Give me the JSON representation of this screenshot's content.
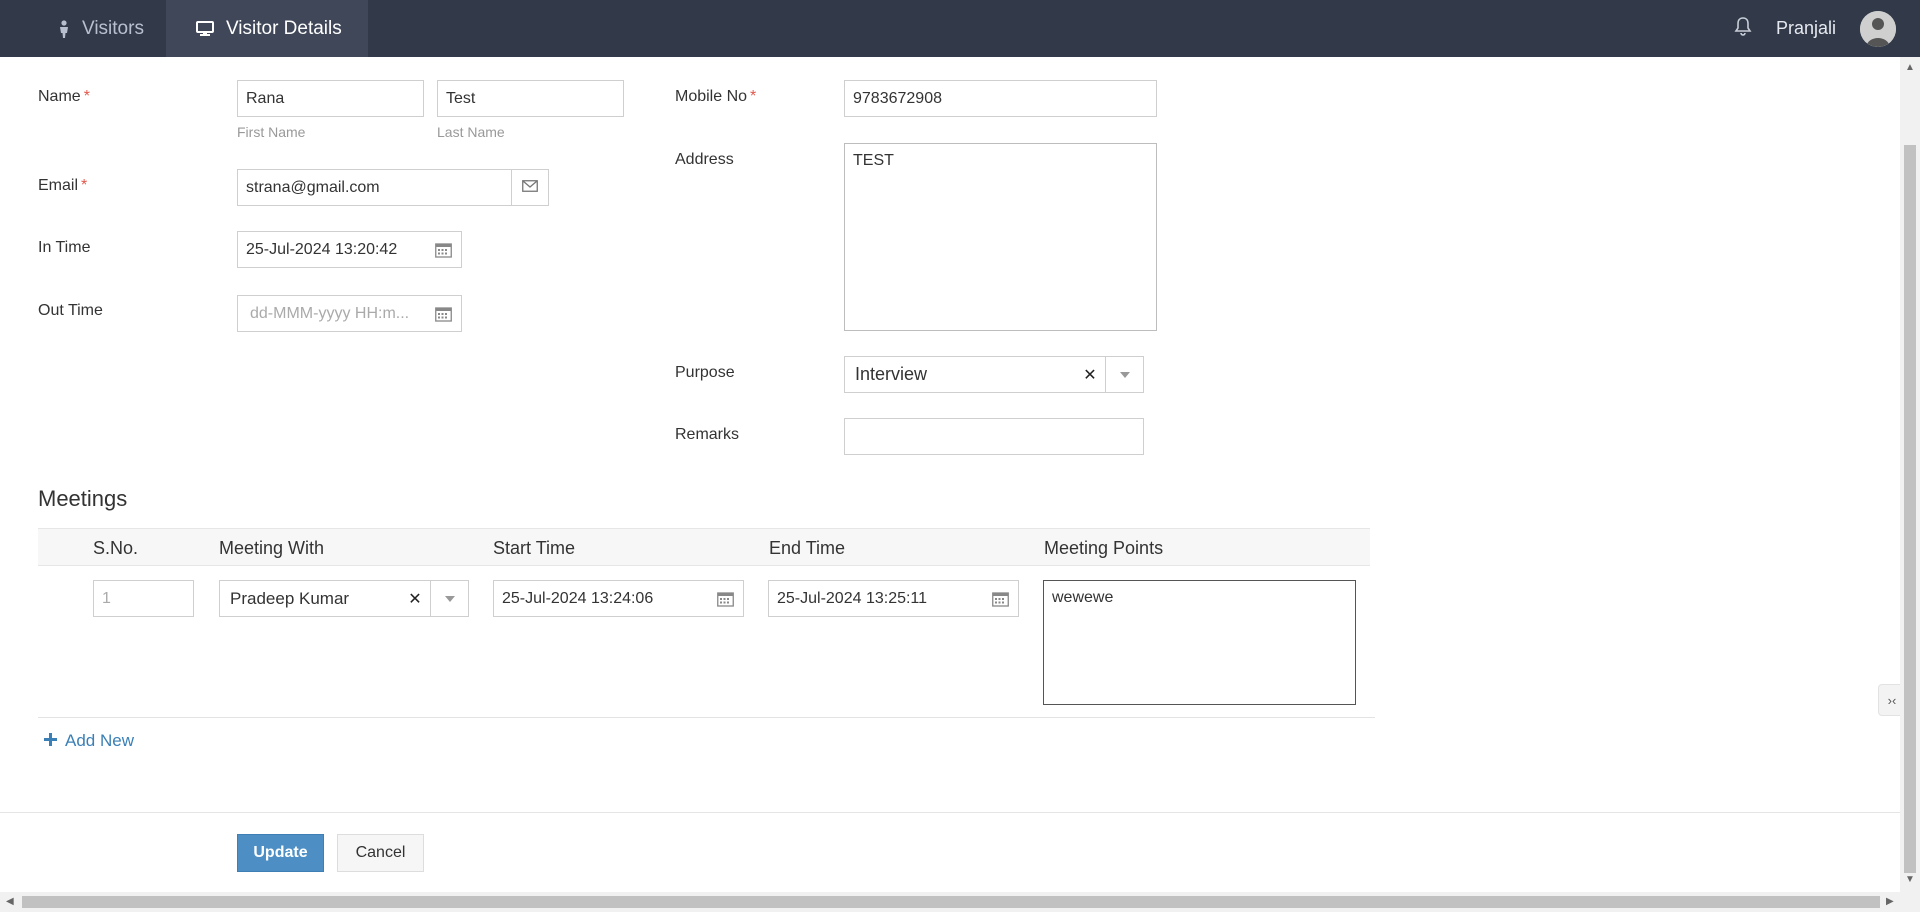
{
  "nav": {
    "tabs": [
      {
        "label": "Visitors",
        "icon": "person-icon"
      },
      {
        "label": "Visitor Details",
        "icon": "monitor-icon"
      }
    ],
    "user_name": "Pranjali"
  },
  "form": {
    "name_label": "Name",
    "first_name": "Rana",
    "last_name": "Test",
    "first_name_hint": "First Name",
    "last_name_hint": "Last Name",
    "email_label": "Email",
    "email": "strana@gmail.com",
    "in_time_label": "In Time",
    "in_time": "25-Jul-2024 13:20:42",
    "out_time_label": "Out Time",
    "out_time_placeholder": "dd-MMM-yyyy HH:m...",
    "mobile_label": "Mobile No",
    "mobile": "9783672908",
    "address_label": "Address",
    "address": "TEST",
    "purpose_label": "Purpose",
    "purpose": "Interview",
    "remarks_label": "Remarks",
    "remarks": "",
    "required_mark": "*"
  },
  "meetings": {
    "title": "Meetings",
    "columns": [
      "S.No.",
      "Meeting With",
      "Start Time",
      "End Time",
      "Meeting Points"
    ],
    "rows": [
      {
        "sno": "1",
        "meeting_with": "Pradeep Kumar",
        "start_time": "25-Jul-2024 13:24:06",
        "end_time": "25-Jul-2024 13:25:11",
        "points": "wewewe"
      }
    ],
    "add_new_label": "Add New"
  },
  "actions": {
    "update_label": "Update",
    "cancel_label": "Cancel"
  },
  "colors": {
    "topbar": "#323a4a",
    "accent": "#4d8fc4",
    "link": "#3a7fb5",
    "required": "#e2574c"
  }
}
